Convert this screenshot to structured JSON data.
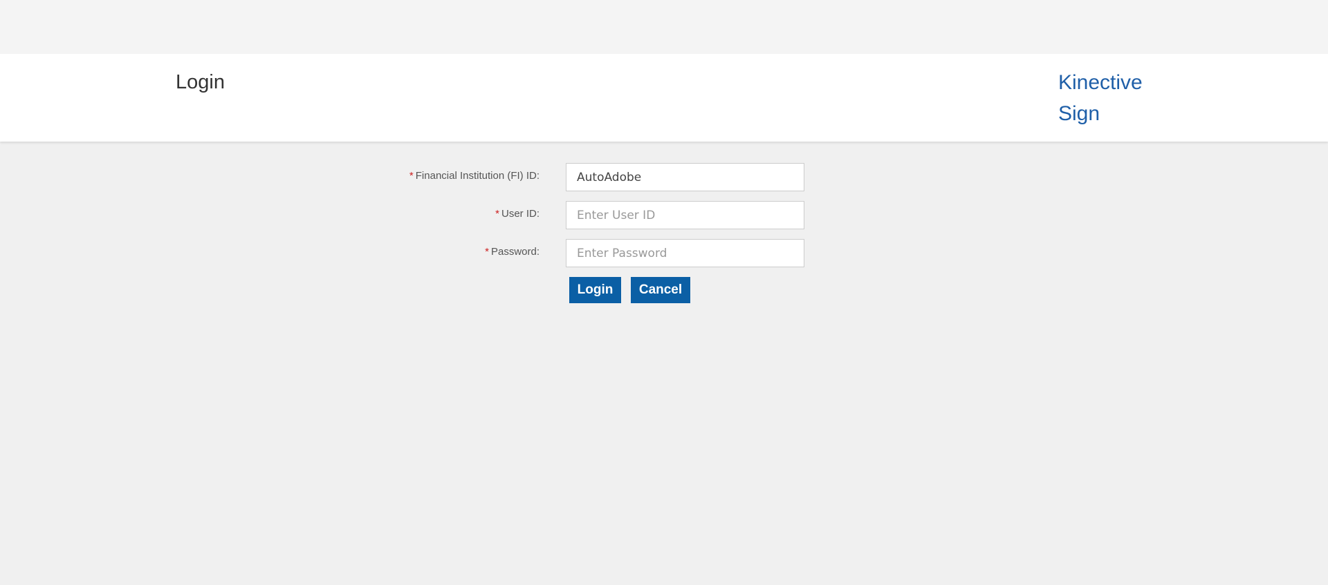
{
  "header": {
    "title": "Login",
    "brand": "Kinective Sign"
  },
  "form": {
    "fi_id": {
      "required_mark": "*",
      "label": "Financial Institution (FI) ID:",
      "value": "AutoAdobe",
      "placeholder": ""
    },
    "user_id": {
      "required_mark": "*",
      "label": "User ID:",
      "value": "",
      "placeholder": "Enter User ID"
    },
    "password": {
      "required_mark": "*",
      "label": "Password:",
      "value": "",
      "placeholder": "Enter Password"
    }
  },
  "buttons": {
    "login": "Login",
    "cancel": "Cancel"
  },
  "colors": {
    "accent": "#0b5fa5",
    "brand": "#1f5fa8",
    "required": "#cc1f1f"
  }
}
